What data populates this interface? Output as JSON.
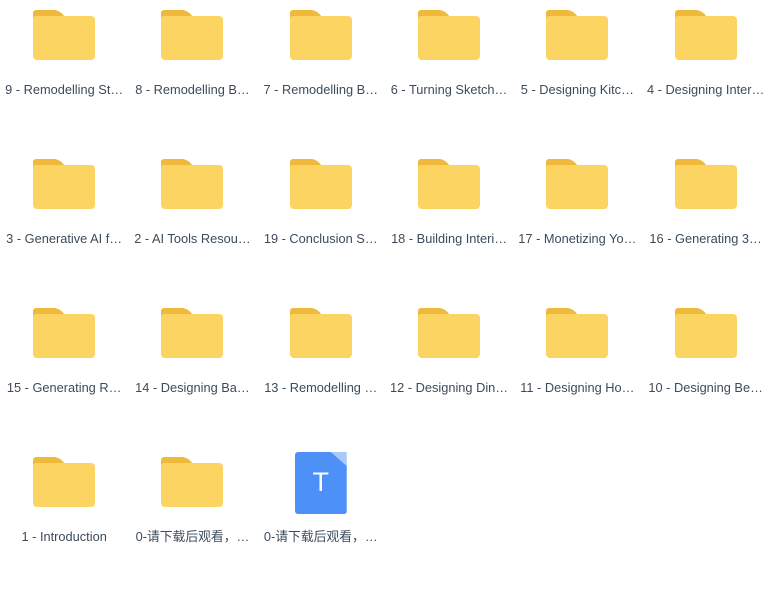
{
  "view": {
    "type": "file-grid",
    "background_color": "#ffffff",
    "columns": 6,
    "rows": 4,
    "total_items": 21,
    "label_color": "#3C4B5A",
    "folder_color": "#FCD462",
    "folder_tab_color": "#EFBA3C",
    "document_color": "#4D90F8"
  },
  "items": [
    {
      "icon": "folder-icon",
      "icon_type": "folder",
      "label": "9 - Remodelling St…"
    },
    {
      "icon": "folder-icon",
      "icon_type": "folder",
      "label": "8 - Remodelling B…"
    },
    {
      "icon": "folder-icon",
      "icon_type": "folder",
      "label": "7 - Remodelling B…"
    },
    {
      "icon": "folder-icon",
      "icon_type": "folder",
      "label": "6 - Turning Sketch…"
    },
    {
      "icon": "folder-icon",
      "icon_type": "folder",
      "label": "5 - Designing Kitc…"
    },
    {
      "icon": "folder-icon",
      "icon_type": "folder",
      "label": "4 - Designing Inter…"
    },
    {
      "icon": "folder-icon",
      "icon_type": "folder",
      "label": "3 - Generative AI f…"
    },
    {
      "icon": "folder-icon",
      "icon_type": "folder",
      "label": "2 - AI Tools Resou…"
    },
    {
      "icon": "folder-icon",
      "icon_type": "folder",
      "label": "19 - Conclusion S…"
    },
    {
      "icon": "folder-icon",
      "icon_type": "folder",
      "label": "18 - Building Interi…"
    },
    {
      "icon": "folder-icon",
      "icon_type": "folder",
      "label": "17 - Monetizing Yo…"
    },
    {
      "icon": "folder-icon",
      "icon_type": "folder",
      "label": "16 - Generating 3…"
    },
    {
      "icon": "folder-icon",
      "icon_type": "folder",
      "label": "15 - Generating R…"
    },
    {
      "icon": "folder-icon",
      "icon_type": "folder",
      "label": "14 - Designing Ba…"
    },
    {
      "icon": "folder-icon",
      "icon_type": "folder",
      "label": "13 - Remodelling …"
    },
    {
      "icon": "folder-icon",
      "icon_type": "folder",
      "label": "12 - Designing Din…"
    },
    {
      "icon": "folder-icon",
      "icon_type": "folder",
      "label": "11 - Designing Ho…"
    },
    {
      "icon": "folder-icon",
      "icon_type": "folder",
      "label": "10 - Designing Be…"
    },
    {
      "icon": "folder-icon",
      "icon_type": "folder",
      "label": "1 - Introduction"
    },
    {
      "icon": "folder-icon",
      "icon_type": "folder",
      "label": "0-请下载后观看，…"
    },
    {
      "icon": "text-document-icon",
      "icon_type": "document",
      "label": "0-请下载后观看，…",
      "document_letter": "T"
    }
  ]
}
